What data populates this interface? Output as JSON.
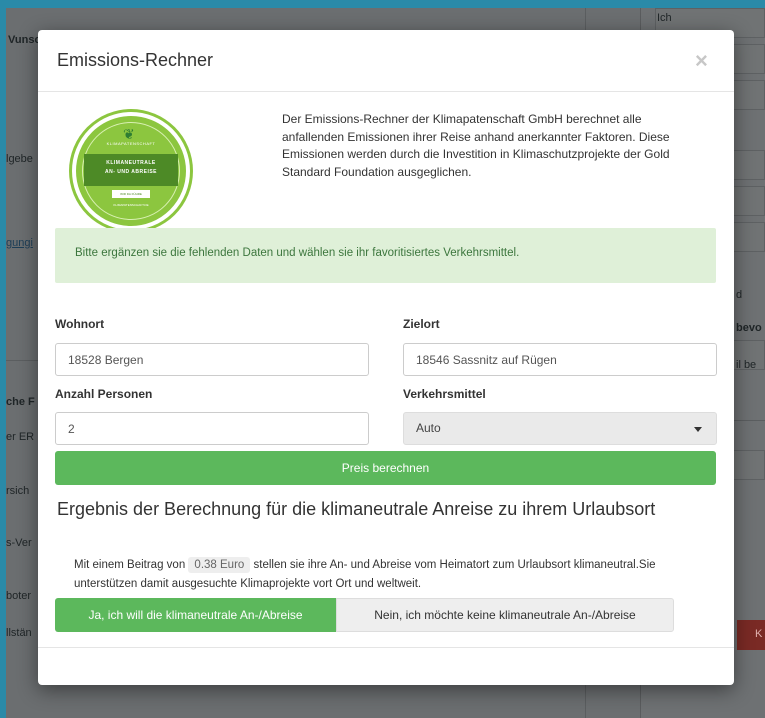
{
  "background": {
    "texts": {
      "t1": "Vunsc",
      "t2": "lgebe",
      "t3": "gungi",
      "t4": "che F",
      "t5": "er ER",
      "t6": "rsich",
      "t7": "s-Ver",
      "t8": "boter",
      "t9": "llstän",
      "r1": "Ich",
      "r2": "d",
      "r3": "bevo",
      "r4": "il be",
      "r5": "K"
    }
  },
  "modal": {
    "title": "Emissions-Rechner",
    "close": "×",
    "badge": {
      "top": "KLIMAPATENSCHAFT",
      "main1": "KLIMANEUTRALE",
      "main2": "AN- UND ABREISE",
      "small": "WIR DA FÜHRE",
      "bottom": "KLIMAPATENSCHAFT.DE"
    },
    "intro": "Der Emissions-Rechner der Klimapatenschaft GmbH berechnet alle anfallenden Emissionen ihrer Reise anhand anerkannter Faktoren. Diese Emissionen werden durch die Investition in Klimaschutzprojekte der Gold Standard Foundation ausgeglichen.",
    "alert": "Bitte ergänzen sie die fehlenden Daten und wählen sie ihr favoritisiertes Verkehrsmittel.",
    "form": {
      "wohnort_label": "Wohnort",
      "wohnort_value": "18528 Bergen",
      "zielort_label": "Zielort",
      "zielort_value": "18546 Sassnitz auf Rügen",
      "personen_label": "Anzahl Personen",
      "personen_value": "2",
      "verkehr_label": "Verkehrsmittel",
      "verkehr_value": "Auto"
    },
    "calc_button": "Preis berechnen",
    "result": {
      "heading": "Ergebnis der Berechnung für die klimaneutrale Anreise zu ihrem Urlaubsort",
      "text_before": "Mit einem Beitrag von",
      "price": "0.38 Euro",
      "text_after": "stellen sie ihre An- und Abreise vom Heimatort zum Urlaubsort klimaneutral.Sie unterstützen damit ausgesuchte Klimaprojekte vort Ort und weltweit.",
      "yes_button": "Ja, ich will die klimaneutrale An-/Abreise",
      "no_button": "Nein, ich möchte keine klimaneutrale An-/Abreise"
    }
  }
}
